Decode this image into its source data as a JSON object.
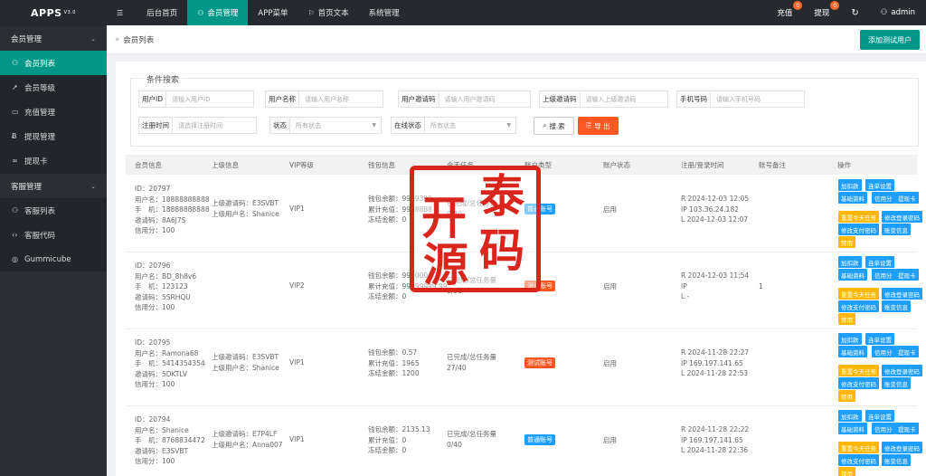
{
  "app": {
    "name": "APPS",
    "version": "V3.0"
  },
  "topnav": [
    {
      "label": "后台首页",
      "icon": "hamburger-icon",
      "active": false
    },
    {
      "label": "会员管理",
      "icon": "user-icon",
      "active": true
    },
    {
      "label": "APP菜单",
      "icon": "",
      "active": false
    },
    {
      "label": "首页文本",
      "icon": "flag-icon",
      "active": false
    },
    {
      "label": "系统管理",
      "icon": "",
      "active": false
    }
  ],
  "topright": {
    "recharge": {
      "label": "充值",
      "count": "0"
    },
    "withdraw": {
      "label": "提现",
      "count": "0"
    },
    "refresh_icon": "refresh-icon",
    "user": "admin"
  },
  "sidebar": {
    "group1": "会员管理",
    "items1": [
      {
        "label": "会员列表",
        "icon": "user-icon"
      },
      {
        "label": "会员等级",
        "icon": "rocket-icon"
      },
      {
        "label": "充值管理",
        "icon": "card-icon"
      },
      {
        "label": "提现管理",
        "icon": "b-icon"
      },
      {
        "label": "提现卡",
        "icon": "link-icon"
      }
    ],
    "group2": "客服管理",
    "items2": [
      {
        "label": "客服列表",
        "icon": "users-icon"
      },
      {
        "label": "客服代码",
        "icon": "code-icon"
      },
      {
        "label": "Gummicube",
        "icon": "globe-icon"
      }
    ]
  },
  "breadcrumb": "会员列表",
  "add_button": "添加测试用户",
  "filter": {
    "title": "条件搜索",
    "fields": [
      {
        "label": "用户ID",
        "placeholder": "请输入用户ID"
      },
      {
        "label": "用户名称",
        "placeholder": "请输入用户名称"
      },
      {
        "label": "用户邀请码",
        "placeholder": "请输入用户邀请码"
      },
      {
        "label": "上级邀请码",
        "placeholder": "请输入上级邀请码"
      },
      {
        "label": "手机号码",
        "placeholder": "请输入手机号码"
      },
      {
        "label": "注册时间",
        "placeholder": "请选择注册时间"
      },
      {
        "label": "状态",
        "placeholder": "所有状态"
      },
      {
        "label": "在线状态",
        "placeholder": "所有状态"
      }
    ],
    "search": "搜 索",
    "export": "导 出"
  },
  "table": {
    "headers": [
      "会员信息",
      "上级信息",
      "VIP等级",
      "钱包信息",
      "今天任务",
      "账户类型",
      "账户状态",
      "注册/登录时间",
      "账号备注",
      "操作"
    ],
    "rows": [
      {
        "member": [
          "ID：20797",
          "用户名：18888888888",
          "手　机：18888888888",
          "邀请码：8A6J7S",
          "信用分：100"
        ],
        "parent": [
          "上级邀请码：E3SVBT",
          "上级用户名：Shanice"
        ],
        "vip": "VIP1",
        "wallet": [
          "钱包余额：9999399",
          "累计充值：9988888",
          "冻结金额：0"
        ],
        "task": [
          "已完成/总任务量",
          "0/40"
        ],
        "type": "普通账号",
        "type_color": "blue",
        "status": "启用",
        "time": [
          "R 2024-12-03 12:05",
          "IP 103.36.24.182",
          "L 2024-12-03 12:07"
        ],
        "remark": ""
      },
      {
        "member": [
          "ID：20796",
          "用户名：BD_8h8v6",
          "手　机：123123",
          "邀请码：5SRHQU",
          "信用分：100"
        ],
        "parent": [],
        "vip": "VIP2",
        "wallet": [
          "钱包余额：990000",
          "累计充值：99999999.99",
          "冻结金额：0"
        ],
        "task": [
          "已完成/总任务量",
          "0/50"
        ],
        "type": "测试账号",
        "type_color": "red",
        "status": "启用",
        "time": [
          "R 2024-12-03 11:54",
          "IP",
          "L -"
        ],
        "remark": "1"
      },
      {
        "member": [
          "ID：20795",
          "用户名：Ramona68",
          "手　机：5414354354",
          "邀请码：5DKTLV",
          "信用分：100"
        ],
        "parent": [
          "上级邀请码：E3SVBT",
          "上级用户名：Shanice"
        ],
        "vip": "VIP1",
        "wallet": [
          "钱包余额：0.57",
          "累计充值：1965",
          "冻结金额：1200"
        ],
        "task": [
          "已完成/总任务量",
          "27/40"
        ],
        "type": "测试账号",
        "type_color": "red",
        "status": "启用",
        "time": [
          "R 2024-11-28 22:27",
          "IP 169.197.141.65",
          "L 2024-11-28 22:53"
        ],
        "remark": ""
      },
      {
        "member": [
          "ID：20794",
          "用户名：Shanice",
          "手　机：8768834472",
          "邀请码：E3SVBT",
          "信用分：100"
        ],
        "parent": [
          "上级邀请码：E7P4LF",
          "上级用户名：Anna007"
        ],
        "vip": "VIP1",
        "wallet": [
          "钱包余额：2135.13",
          "累计充值：0",
          "冻结金额：0"
        ],
        "task": [
          "已完成/总任务量",
          "0/40"
        ],
        "type": "普通账号",
        "type_color": "blue",
        "status": "启用",
        "time": [
          "R 2024-11-28 22:22",
          "IP 169.197.141.65",
          "L 2024-11-28 22:36"
        ],
        "remark": ""
      }
    ],
    "ops": [
      "加扣款",
      "连单设置",
      "基础资料",
      "信用分",
      "提现卡",
      "重置今天任务",
      "修改登录密码",
      "修改支付密码",
      "账变信息",
      "禁用"
    ]
  },
  "seal": {
    "chars": [
      "开",
      "泰",
      "源",
      "码"
    ]
  }
}
